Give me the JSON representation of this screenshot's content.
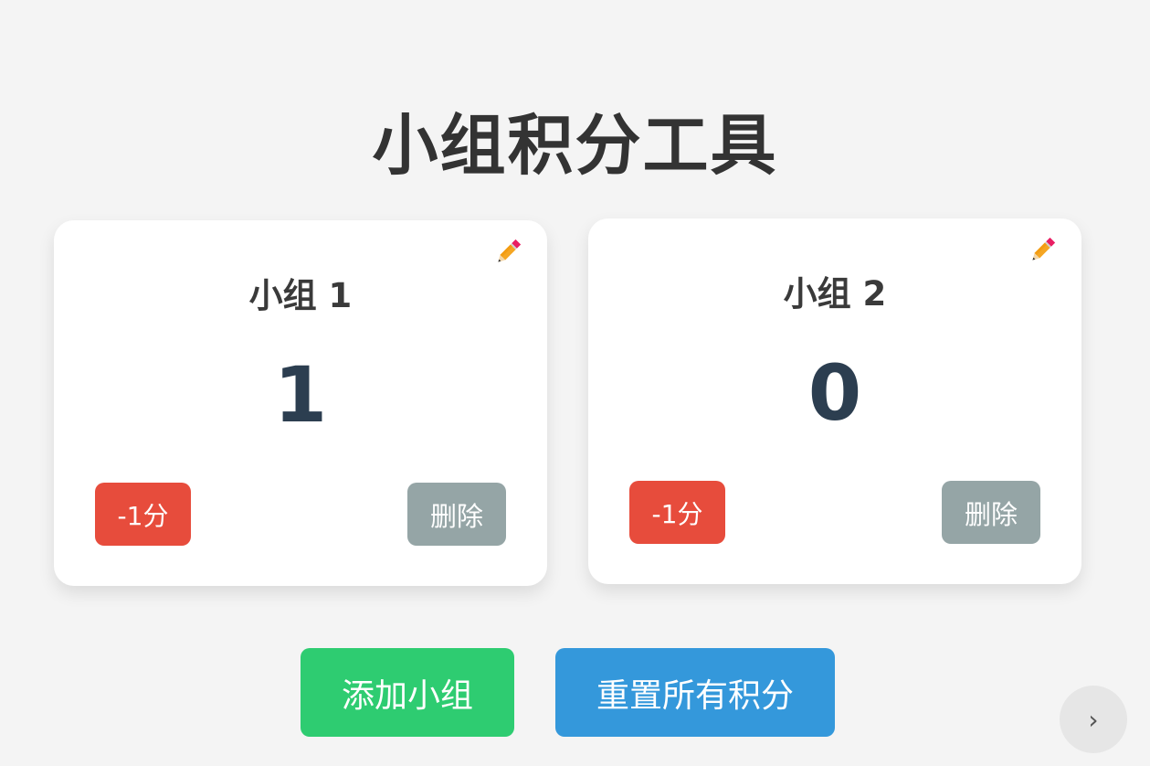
{
  "page": {
    "title": "小组积分工具"
  },
  "groups": [
    {
      "name": "小组 1",
      "score": "1",
      "minus_label": "-1分",
      "delete_label": "删除",
      "edit_icon": "pencil-icon"
    },
    {
      "name": "小组 2",
      "score": "0",
      "minus_label": "-1分",
      "delete_label": "删除",
      "edit_icon": "pencil-icon"
    }
  ],
  "actions": {
    "add_label": "添加小组",
    "reset_label": "重置所有积分"
  },
  "corner_widget": {
    "icon": "chevron-right-icon",
    "glyph": "›"
  },
  "colors": {
    "minus": "#e74c3c",
    "delete": "#95a5a6",
    "add": "#2ecc71",
    "reset": "#3498db",
    "score": "#2c3e50"
  }
}
